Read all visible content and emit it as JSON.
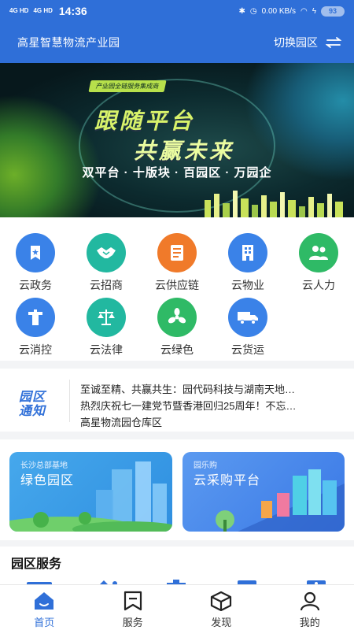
{
  "status_bar": {
    "network1": "4G HD",
    "network2": "4G HD",
    "time": "14:36",
    "speed": "0.00 KB/s",
    "battery": "93"
  },
  "header": {
    "title": "高星智慧物流产业园",
    "switch_label": "切换园区"
  },
  "banner": {
    "tag": "产业园全链服务集成商",
    "headline1": "跟随平台",
    "headline2": "共赢未来",
    "subtitle": "双平台 · 十版块 · 百园区 · 万园企",
    "colors": {
      "accent": "#d8f36a"
    }
  },
  "services": [
    {
      "label": "云政务",
      "icon": "gov-bookmark-icon",
      "color": "#3a82e8"
    },
    {
      "label": "云招商",
      "icon": "handshake-icon",
      "color": "#22b8a0"
    },
    {
      "label": "云供应链",
      "icon": "supply-doc-icon",
      "color": "#f07a2a"
    },
    {
      "label": "云物业",
      "icon": "building-icon",
      "color": "#3a82e8"
    },
    {
      "label": "云人力",
      "icon": "people-icon",
      "color": "#2fba66"
    },
    {
      "label": "云消控",
      "icon": "hydrant-icon",
      "color": "#3a82e8"
    },
    {
      "label": "云法律",
      "icon": "scales-icon",
      "color": "#22b8a0"
    },
    {
      "label": "云绿色",
      "icon": "fan-icon",
      "color": "#2fba66"
    },
    {
      "label": "云货运",
      "icon": "truck-icon",
      "color": "#3a82e8"
    }
  ],
  "notice": {
    "logo_line1": "园区",
    "logo_line2": "通知",
    "items": [
      "至诚至精、共赢共生：园代码科技与湖南天地…",
      "热烈庆祝七一建党节暨香港回归25周年！不忘…",
      "高星物流园仓库区"
    ]
  },
  "cards": [
    {
      "small": "长沙总部基地",
      "big": "绿色园区"
    },
    {
      "small": "园乐购",
      "big": "云采购平台"
    }
  ],
  "section": {
    "title": "园区服务"
  },
  "tabbar": [
    {
      "label": "首页",
      "icon": "home-icon",
      "active": true
    },
    {
      "label": "服务",
      "icon": "service-icon",
      "active": false
    },
    {
      "label": "发现",
      "icon": "discover-box-icon",
      "active": false
    },
    {
      "label": "我的",
      "icon": "profile-icon",
      "active": false
    }
  ]
}
